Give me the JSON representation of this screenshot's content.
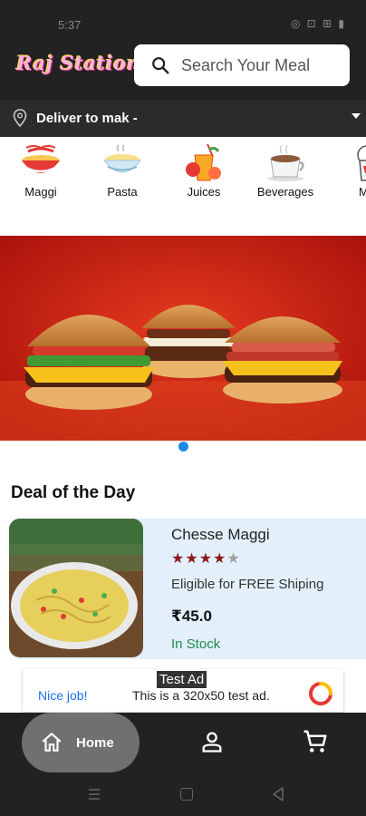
{
  "status": {
    "time": "5:37",
    "icons": "◎ ⊡ ⊞ ▮"
  },
  "header": {
    "logo": "Raj Station",
    "search_placeholder": "Search Your Meal"
  },
  "delivery": {
    "label": "Deliver to mak -"
  },
  "categories": [
    {
      "label": "Maggi",
      "icon": "noodle-bowl-icon"
    },
    {
      "label": "Pasta",
      "icon": "pasta-bowl-icon"
    },
    {
      "label": "Juices",
      "icon": "juice-icon"
    },
    {
      "label": "Beverages",
      "icon": "coffee-cup-icon"
    },
    {
      "label": "Mo",
      "icon": "more-food-icon"
    }
  ],
  "banner": {
    "active_index": 0,
    "count": 1
  },
  "deal": {
    "section_title": "Deal of the Day",
    "name": "Chesse Maggi",
    "rating": 4,
    "rating_max": 5,
    "shipping": "Eligible for FREE Shiping",
    "price": "₹45.0",
    "stock": "In Stock"
  },
  "ad": {
    "tag": "Test Ad",
    "nice": "Nice job!",
    "text": "This is a 320x50 test ad."
  },
  "bottom_nav": {
    "home_label": "Home"
  },
  "colors": {
    "dark": "#222222",
    "accent_blue": "#1e88e5",
    "stock_green": "#1e8a4a",
    "star_red": "#8b1a1a"
  }
}
